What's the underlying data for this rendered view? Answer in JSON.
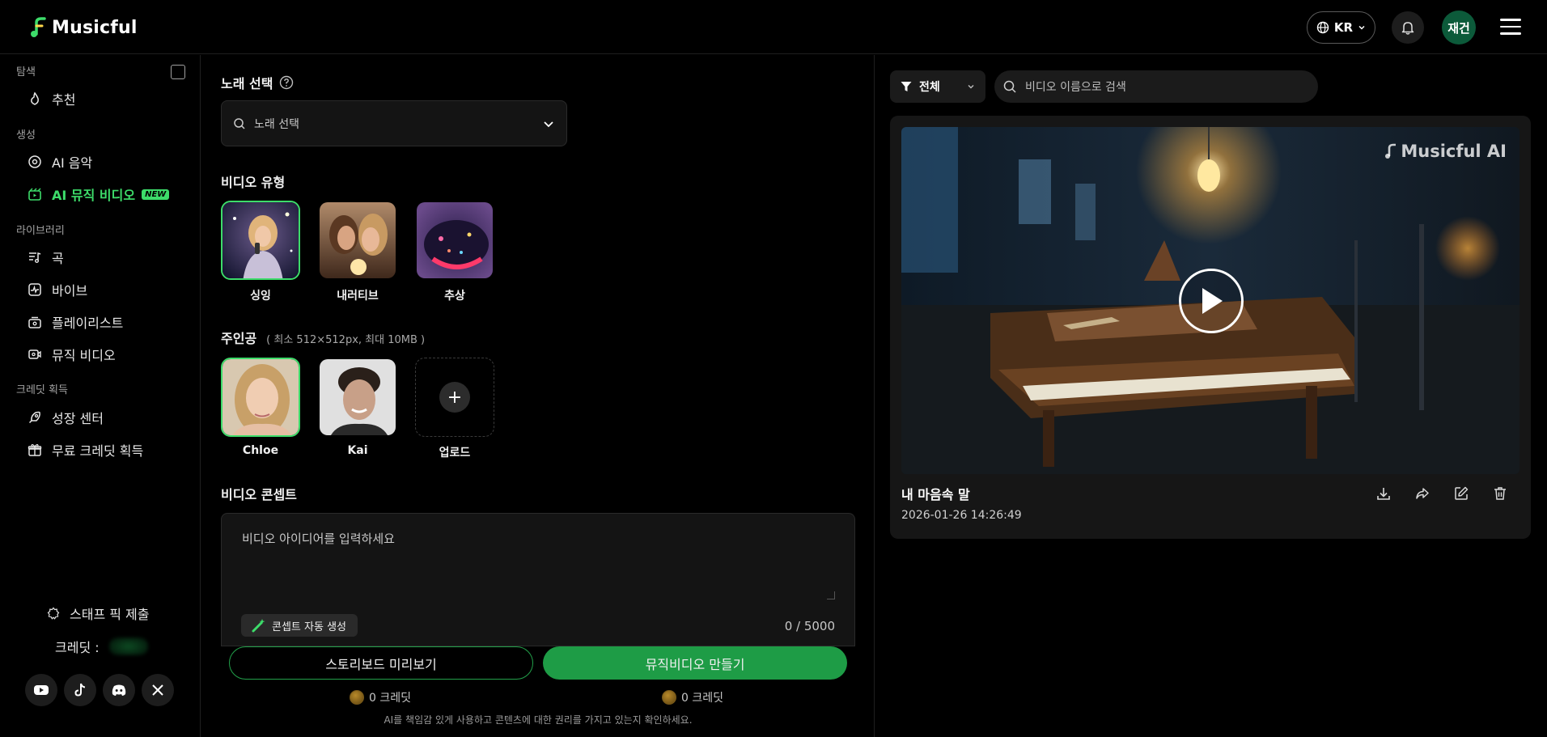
{
  "app": {
    "name": "Musicful",
    "accent": "#3ddc6a"
  },
  "header": {
    "lang": "KR",
    "avatar_text": "재건"
  },
  "sidebar": {
    "sections": [
      "탐색",
      "생성",
      "라이브러리",
      "크레딧 획득"
    ],
    "items": [
      {
        "label": "추천",
        "icon": "flame-icon"
      },
      {
        "label": "AI 음악",
        "icon": "disc-icon"
      },
      {
        "label": "AI 뮤직 비디오",
        "icon": "video-icon",
        "badge": "NEW",
        "active": true
      },
      {
        "label": "곡",
        "icon": "music-list-icon"
      },
      {
        "label": "바이브",
        "icon": "pulse-icon"
      },
      {
        "label": "플레이리스트",
        "icon": "playlist-icon"
      },
      {
        "label": "뮤직 비디오",
        "icon": "movie-icon"
      },
      {
        "label": "성장 센터",
        "icon": "rocket-icon"
      },
      {
        "label": "무료 크레딧 획득",
        "icon": "gift-icon"
      }
    ],
    "staff_pick": "스태프 픽 제출",
    "credits_label": "크레딧 :",
    "socials": [
      "youtube-icon",
      "tiktok-icon",
      "discord-icon",
      "x-icon"
    ]
  },
  "form": {
    "song_label": "노래 선택",
    "song_placeholder": "노래 선택",
    "video_type_label": "비디오 유형",
    "video_types": [
      {
        "label": "싱잉",
        "selected": true
      },
      {
        "label": "내러티브",
        "selected": false
      },
      {
        "label": "추상",
        "selected": false
      }
    ],
    "protagonist_label": "주인공",
    "protagonist_hint": "( 최소 512×512px, 최대 10MB )",
    "protagonists": [
      {
        "label": "Chloe",
        "selected": true
      },
      {
        "label": "Kai",
        "selected": false
      }
    ],
    "upload_label": "업로드",
    "concept_label": "비디오 콘셉트",
    "concept_placeholder": "비디오 아이디어를 입력하세요",
    "auto_concept": "콘셉트 자동 생성",
    "counter": "0 / 5000",
    "storyboard_btn": "스토리보드 미리보기",
    "create_btn": "뮤직비디오 만들기",
    "storyboard_cost": "0 크레딧",
    "create_cost": "0 크레딧",
    "disclaimer": "AI를 책임감 있게 사용하고 콘텐츠에 대한 권리를 가지고 있는지 확인하세요."
  },
  "library": {
    "filter": "전체",
    "search_placeholder": "비디오 이름으로 검색",
    "video": {
      "watermark": "Musicful AI",
      "title": "내 마음속 말",
      "date": "2026-01-26 14:26:49"
    }
  }
}
